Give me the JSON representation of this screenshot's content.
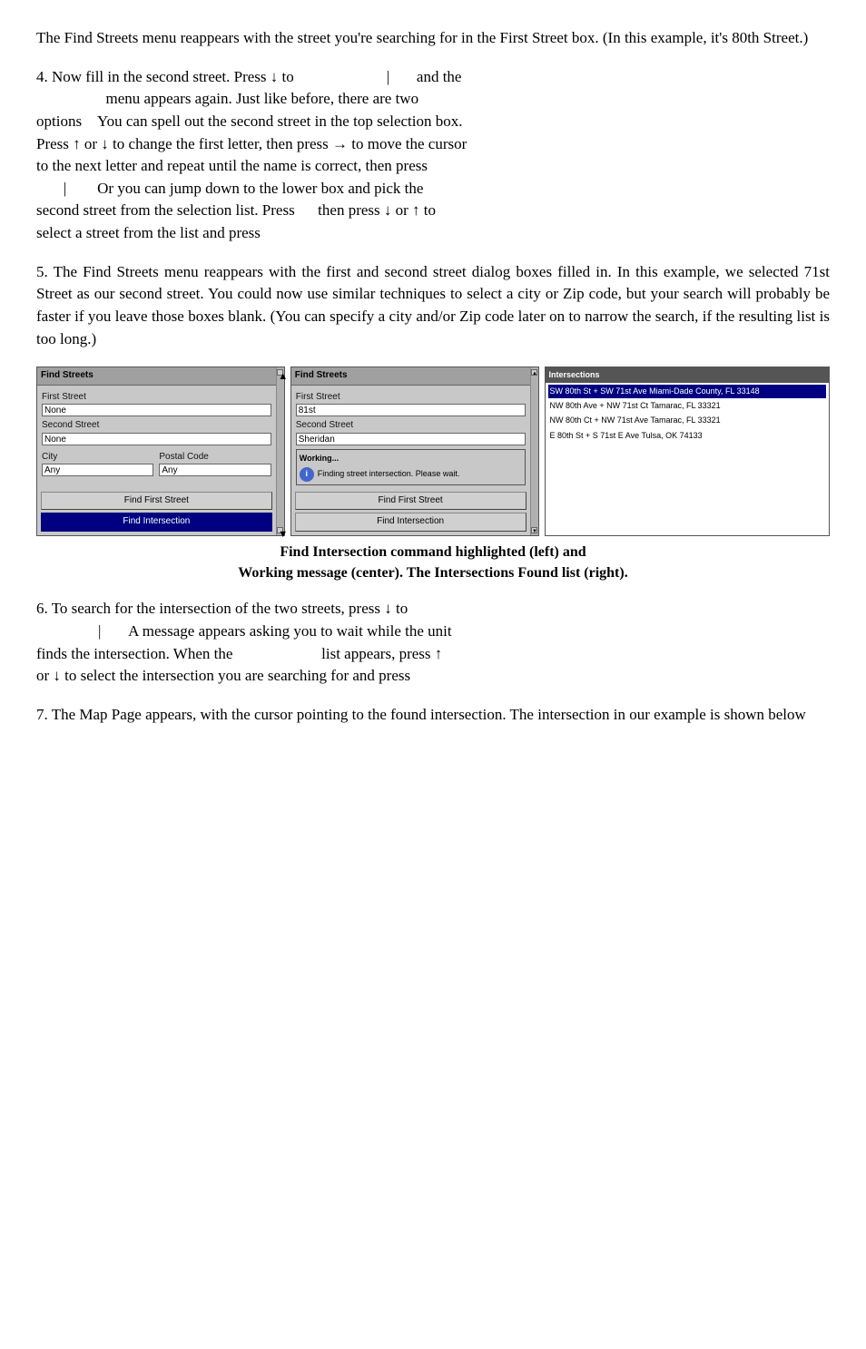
{
  "paragraphs": {
    "intro": "The Find Streets menu reappears with the street you're searching for in the First Street box. (In this example, it's 80th Street.)",
    "step4_line1": "4. Now fill in the second street. Press ↓ to",
    "step4_line1b": "| and the",
    "step4_line2": "menu appears again. Just like before, there are two options    You can spell out the second street in the top selection box. Press ↑ or ↓ to change the first letter, then press → to move the cursor to the next letter and repeat until the name is correct, then press",
    "step4_line3": "       |        Or you can jump down to the lower box and pick the second street from the selection list. Press      then press ↓ or ↑ to select a street from the list and press",
    "step5": "5. The Find Streets menu reappears with the first and second street dialog boxes filled in. In this example, we selected 71st Street as our second street. You could now use similar techniques to select a city or Zip code, but your search will probably be faster if you leave those boxes blank. (You can specify a city and/or Zip code later on to narrow the search, if the resulting list is too long.)",
    "caption_line1": "Find Intersection command highlighted (left) and",
    "caption_line2": "Working message (center). The Intersections Found list (right).",
    "step6": "6. To search for the intersection of the two streets, press ↓ to",
    "step6b": "         |       A message appears asking you to wait while the unit finds the intersection. When the                              list appears, press ↑ or ↓ to select the intersection you are searching for and press",
    "step7": "7. The Map Page appears, with the cursor pointing to the found intersection. The intersection in our example is shown below"
  },
  "left_panel": {
    "title": "Find Streets",
    "first_street_label": "First Street",
    "first_street_value": "None",
    "second_street_label": "Second Street",
    "second_street_value": "None",
    "city_label": "City",
    "city_value": "Any",
    "postal_label": "Postal Code",
    "postal_value": "Any",
    "btn1": "Find First Street",
    "btn2": "Find Intersection",
    "btn2_highlighted": true
  },
  "center_panel": {
    "title": "Find Streets",
    "first_street_label": "First Street",
    "first_street_value": "81st",
    "second_street_label": "Second Street",
    "second_street_value": "Sheridan",
    "working_label": "Working...",
    "working_msg": "Finding street intersection.  Please wait.",
    "btn1": "Find First Street",
    "btn2": "Find Intersection",
    "btn2_highlighted": false
  },
  "right_panel": {
    "title": "Intersections",
    "items": [
      {
        "text": "SW 80th St + SW 71st Ave Miami-Dade County, FL  33148",
        "selected": true
      },
      {
        "text": "NW 80th Ave + NW 71st Ct Tamarac, FL  33321",
        "selected": false
      },
      {
        "text": "NW 80th Ct + NW 71st Ave Tamarac, FL  33321",
        "selected": false
      },
      {
        "text": "E 80th St + S 71st E Ave Tulsa, OK  74133",
        "selected": false
      }
    ]
  }
}
